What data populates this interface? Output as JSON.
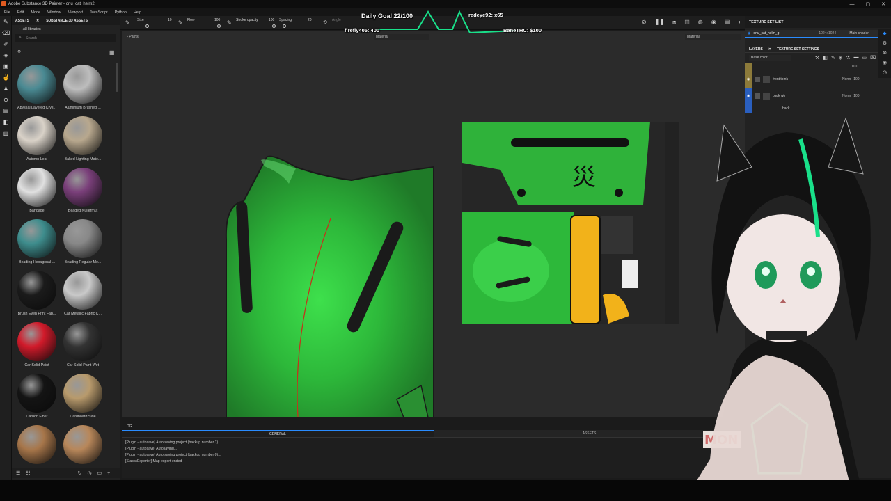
{
  "app": {
    "title": "Adobe Substance 3D Painter - onu_cat_helm2"
  },
  "menu": [
    "File",
    "Edit",
    "Mode",
    "Window",
    "Viewport",
    "JavaScript",
    "Python",
    "Help"
  ],
  "window_controls": [
    "—",
    "▢",
    "✕"
  ],
  "assets_panel": {
    "tabs": [
      "ASSETS",
      "SUBSTANCE 3D ASSETS"
    ],
    "library": "All libraries",
    "search_placeholder": "Search",
    "items": [
      {
        "label": "Abyssal Layered Crys...",
        "color": "#4a8a93"
      },
      {
        "label": "Aluminium Brushed ...",
        "color": "#bdbdbd"
      },
      {
        "label": "Autumn Leaf",
        "color": "#d9d2c8"
      },
      {
        "label": "Baked Lighting Mate...",
        "color": "#b8a88e"
      },
      {
        "label": "Bandage",
        "color": "#e0e0e0"
      },
      {
        "label": "Beaded Nullermut",
        "color": "#7a3f7a"
      },
      {
        "label": "Beading Hexagonal ...",
        "color": "#3e8d8d"
      },
      {
        "label": "Beading Regular Me...",
        "color": "#888888"
      },
      {
        "label": "Brush Even Print Fab...",
        "color": "#1b1b1b"
      },
      {
        "label": "Car Metallic Fabric C...",
        "color": "#c9c9c9"
      },
      {
        "label": "Car Solid Paint",
        "color": "#d11a2a"
      },
      {
        "label": "Car Solid Paint Wet",
        "color": "#333333"
      },
      {
        "label": "Carbon Fiber",
        "color": "#141414"
      },
      {
        "label": "Cardboard Side",
        "color": "#b89a6c"
      },
      {
        "label": "",
        "color": "#a7764a"
      },
      {
        "label": "",
        "color": "#b8875a"
      }
    ]
  },
  "toolbar": {
    "size_label": "Size",
    "size_value": "10",
    "flow_label": "Flow",
    "flow_value": "100",
    "stroke_label": "Stroke opacity",
    "stroke_value": "100",
    "spacing_label": "Spacing",
    "spacing_value": "20",
    "angle_label": "Angle"
  },
  "viewport": {
    "paths_label": "Paths",
    "mode_left": "Material",
    "mode_right": "Material"
  },
  "log": {
    "title": "LOG",
    "tabs": [
      "GENERAL",
      "ASSETS"
    ],
    "lines": [
      "[Plugin - autosave] Auto saving project (backup number 1)...",
      "[Plugin - autosave] Autosaving...",
      "[Plugin - autosave] Auto saving project (backup number 0)...",
      "[StacksExporter] Map export ended"
    ]
  },
  "texture_set": {
    "title": "TEXTURE SET LIST",
    "name": "onu_cat_helm_g",
    "resolution": "1024x1024",
    "shader": "Main shader"
  },
  "layers": {
    "tabs": [
      "LAYERS",
      "TEXTURE SET SETTINGS"
    ],
    "channel": "Base color",
    "items": [
      {
        "name": "",
        "blend": "",
        "opacity": "100"
      },
      {
        "name": "front tpink",
        "blend": "Norm",
        "opacity": "100"
      },
      {
        "name": "back wh",
        "blend": "Norm",
        "opacity": "100"
      },
      {
        "name": "back",
        "blend": "",
        "opacity": ""
      }
    ]
  },
  "overlay": {
    "goal": "Daily Goal 22/100",
    "user1": "redeye92: x65",
    "user2": "firefly405: 400",
    "user3": "BaneTHC: $100",
    "badge": "MON"
  },
  "colors": {
    "accent": "#2a8cff",
    "helmet_green": "#2fb23a",
    "neon": "#19e08a"
  }
}
